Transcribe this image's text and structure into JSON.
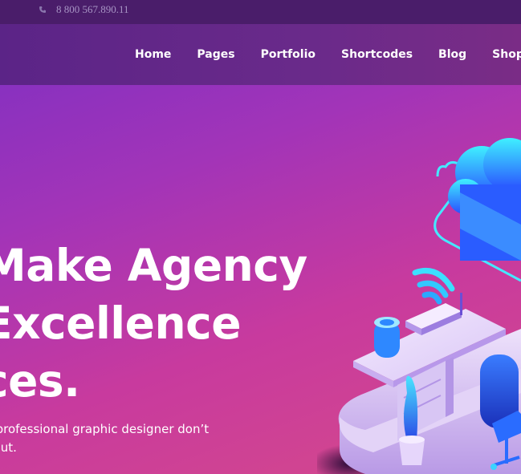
{
  "topbar": {
    "phone_icon": "phone-icon",
    "phone": "8 800 567.890.11"
  },
  "nav": {
    "items": [
      {
        "label": "Home"
      },
      {
        "label": "Pages"
      },
      {
        "label": "Portfolio"
      },
      {
        "label": "Shortcodes"
      },
      {
        "label": "Blog"
      },
      {
        "label": "Shop"
      }
    ]
  },
  "hero": {
    "line1": "Make Agency",
    "line2": "Excellence",
    "line3": "ces.",
    "sub1": "s professional graphic designer don’t",
    "sub2": "bout."
  },
  "colors": {
    "topbar": "#4a1d6a",
    "navbar": "#5b2487",
    "gradient_start": "#7a2fc4",
    "gradient_end": "#d54a8a"
  }
}
